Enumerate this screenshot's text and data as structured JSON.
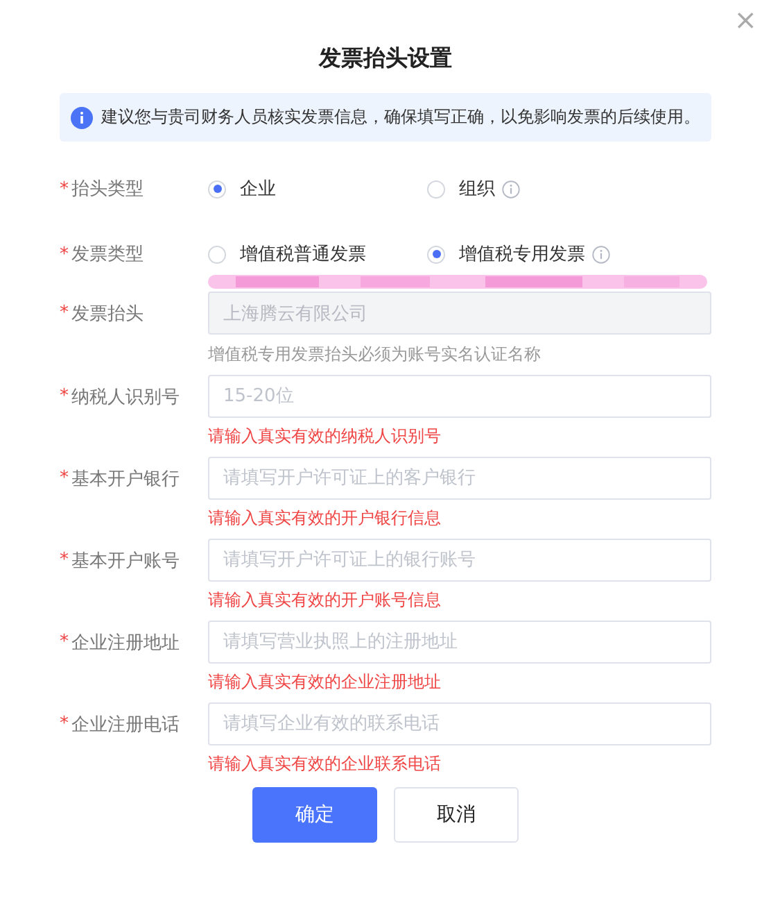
{
  "dialog": {
    "title": "发票抬头设置",
    "close": "×"
  },
  "notice": "建议您与贵司财务人员核实发票信息，确保填写正确，以免影响发票的后续使用。",
  "radio_groups": [
    {
      "mark": "*",
      "label": "抬头类型",
      "options": [
        {
          "label": "企业",
          "selected": true,
          "info": false
        },
        {
          "label": "组织",
          "selected": false,
          "info": true
        }
      ]
    },
    {
      "mark": "*",
      "label": "发票类型",
      "options": [
        {
          "label": "增值税普通发票",
          "selected": false,
          "info": false
        },
        {
          "label": "增值税专用发票",
          "selected": true,
          "info": true
        }
      ]
    }
  ],
  "fields": [
    {
      "mark": "*",
      "label": "发票抬头",
      "disabled": true,
      "value": "上海腾云有限公司",
      "hint": "增值税专用发票抬头必须为账号实名认证名称"
    },
    {
      "mark": "*",
      "label": "纳税人识别号",
      "disabled": false,
      "placeholder": "15-20位",
      "error": "请输入真实有效的纳税人识别号"
    },
    {
      "mark": "*",
      "label": "基本开户银行",
      "disabled": false,
      "placeholder": "请填写开户许可证上的客户银行",
      "error": "请输入真实有效的开户银行信息"
    },
    {
      "mark": "*",
      "label": "基本开户账号",
      "disabled": false,
      "placeholder": "请填写开户许可证上的银行账号",
      "error": "请输入真实有效的开户账号信息"
    },
    {
      "mark": "*",
      "label": "企业注册地址",
      "disabled": false,
      "placeholder": "请填写营业执照上的注册地址",
      "error": "请输入真实有效的企业注册地址"
    },
    {
      "mark": "*",
      "label": "企业注册电话",
      "disabled": false,
      "placeholder": "请填写企业有效的联系电话",
      "error": "请输入真实有效的企业联系电话"
    }
  ],
  "buttons": [
    {
      "label": "确定",
      "kind": "primary"
    },
    {
      "label": "取消",
      "kind": "secondary"
    }
  ]
}
